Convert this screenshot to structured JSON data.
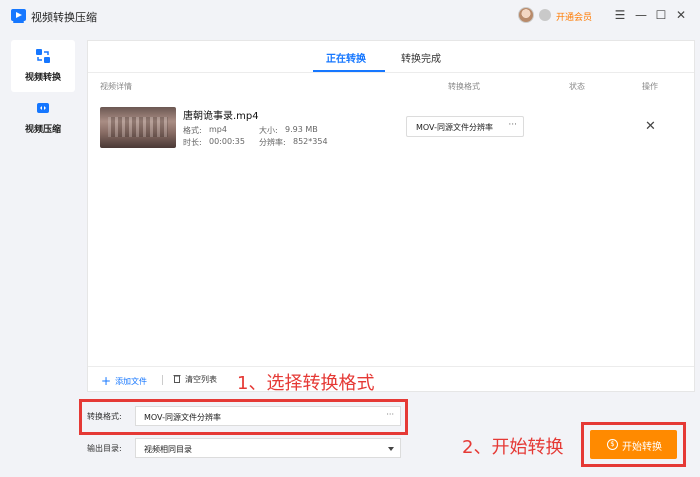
{
  "app": {
    "title": "视频转换压缩",
    "vip_label": "开通会员"
  },
  "window_controls": {
    "menu": "☰",
    "minimize": "—",
    "maximize": "☐",
    "close": "✕"
  },
  "sidebar": {
    "items": [
      {
        "label": "视频转换",
        "icon": "video-convert-icon",
        "active": true
      },
      {
        "label": "视频压缩",
        "icon": "video-compress-icon",
        "active": false
      }
    ]
  },
  "tabs": [
    {
      "label": "正在转换",
      "active": true
    },
    {
      "label": "转换完成",
      "active": false
    }
  ],
  "columns": {
    "details": "视频详情",
    "format": "转换格式",
    "status": "状态",
    "action": "操作"
  },
  "file": {
    "name": "唐朝诡事录.mp4",
    "format_label": "格式:",
    "format_value": "mp4",
    "size_label": "大小:",
    "size_value": "9.93 MB",
    "duration_label": "时长:",
    "duration_value": "00:00:35",
    "resolution_label": "分辨率:",
    "resolution_value": "852*354",
    "convert_format": "MOV-同源文件分辨率"
  },
  "toolbar": {
    "add_file": "添加文件",
    "clear_list": "清空列表"
  },
  "settings": {
    "format_label": "转换格式:",
    "format_value": "MOV-同源文件分辨率",
    "output_label": "输出目录:",
    "output_value": "视频相同目录"
  },
  "start_button": "开始转换",
  "annotations": {
    "step1": "1、选择转换格式",
    "step2": "2、开始转换"
  },
  "colors": {
    "accent": "#1677ff",
    "primary_button": "#ff8a00",
    "annotation": "#e53935"
  }
}
